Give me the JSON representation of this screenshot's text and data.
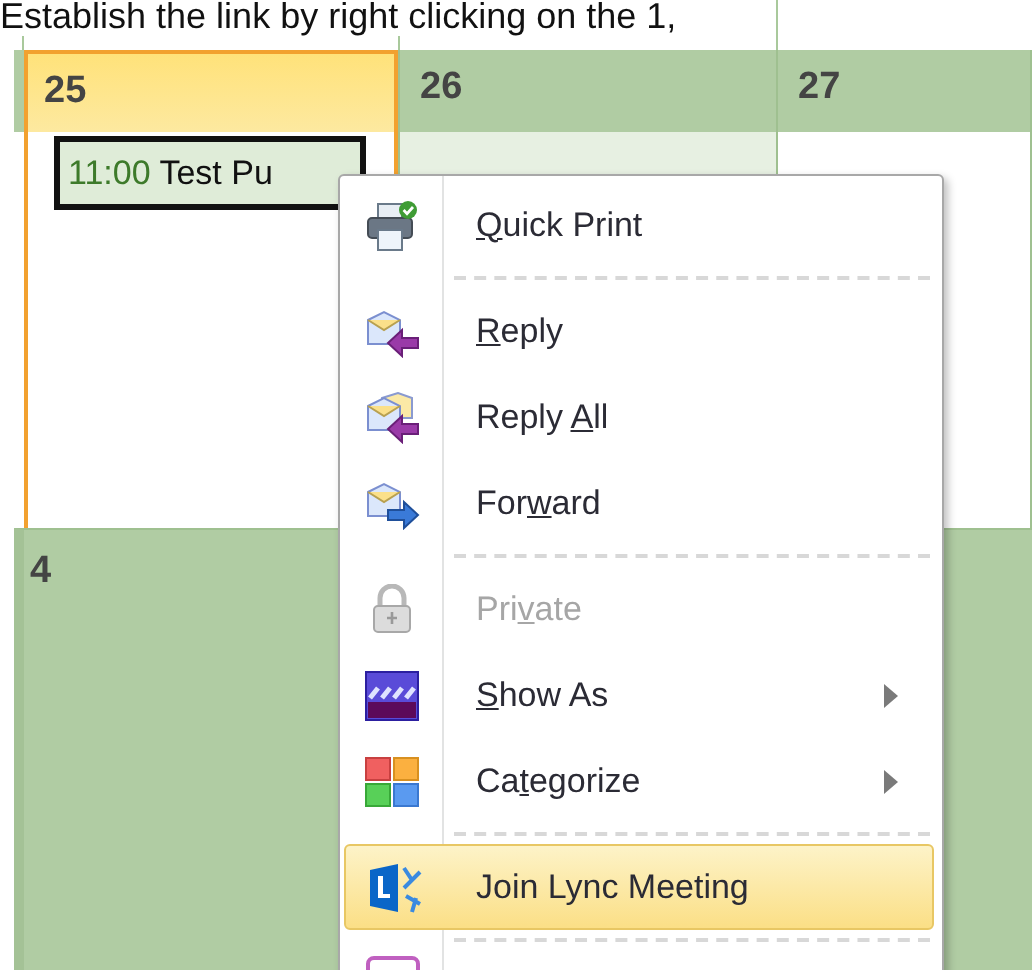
{
  "caption": "Establish the link by right clicking on the 1,",
  "calendar": {
    "header": [
      {
        "day": "25",
        "selected": true
      },
      {
        "day": "26",
        "selected": false
      },
      {
        "day": "27",
        "selected": false
      }
    ],
    "event": {
      "time": "11:00",
      "title": "Test Pu"
    },
    "next_week": {
      "day": "4"
    }
  },
  "context_menu": [
    {
      "kind": "item",
      "key": "Q",
      "after": "uick Print",
      "disabled": false,
      "submenu": false,
      "selected": false
    },
    {
      "kind": "separator"
    },
    {
      "kind": "item",
      "key": "R",
      "after": "eply",
      "disabled": false,
      "submenu": false,
      "selected": false
    },
    {
      "kind": "item",
      "before": "Reply ",
      "key": "A",
      "after": "ll",
      "disabled": false,
      "submenu": false,
      "selected": false
    },
    {
      "kind": "item",
      "before": "For",
      "key": "w",
      "after": "ard",
      "disabled": false,
      "submenu": false,
      "selected": false
    },
    {
      "kind": "separator"
    },
    {
      "kind": "item",
      "before": "Pri",
      "key": "v",
      "after": "ate",
      "disabled": true,
      "submenu": false,
      "selected": false
    },
    {
      "kind": "item",
      "key": "S",
      "after": "how As",
      "disabled": false,
      "submenu": true,
      "selected": false
    },
    {
      "kind": "item",
      "before": "Ca",
      "key": "t",
      "after": "egorize",
      "disabled": false,
      "submenu": true,
      "selected": false
    },
    {
      "kind": "separator"
    },
    {
      "kind": "item",
      "before": "Join Lync Meeting",
      "disabled": false,
      "submenu": false,
      "selected": true
    },
    {
      "kind": "separator"
    },
    {
      "kind": "partial"
    }
  ]
}
